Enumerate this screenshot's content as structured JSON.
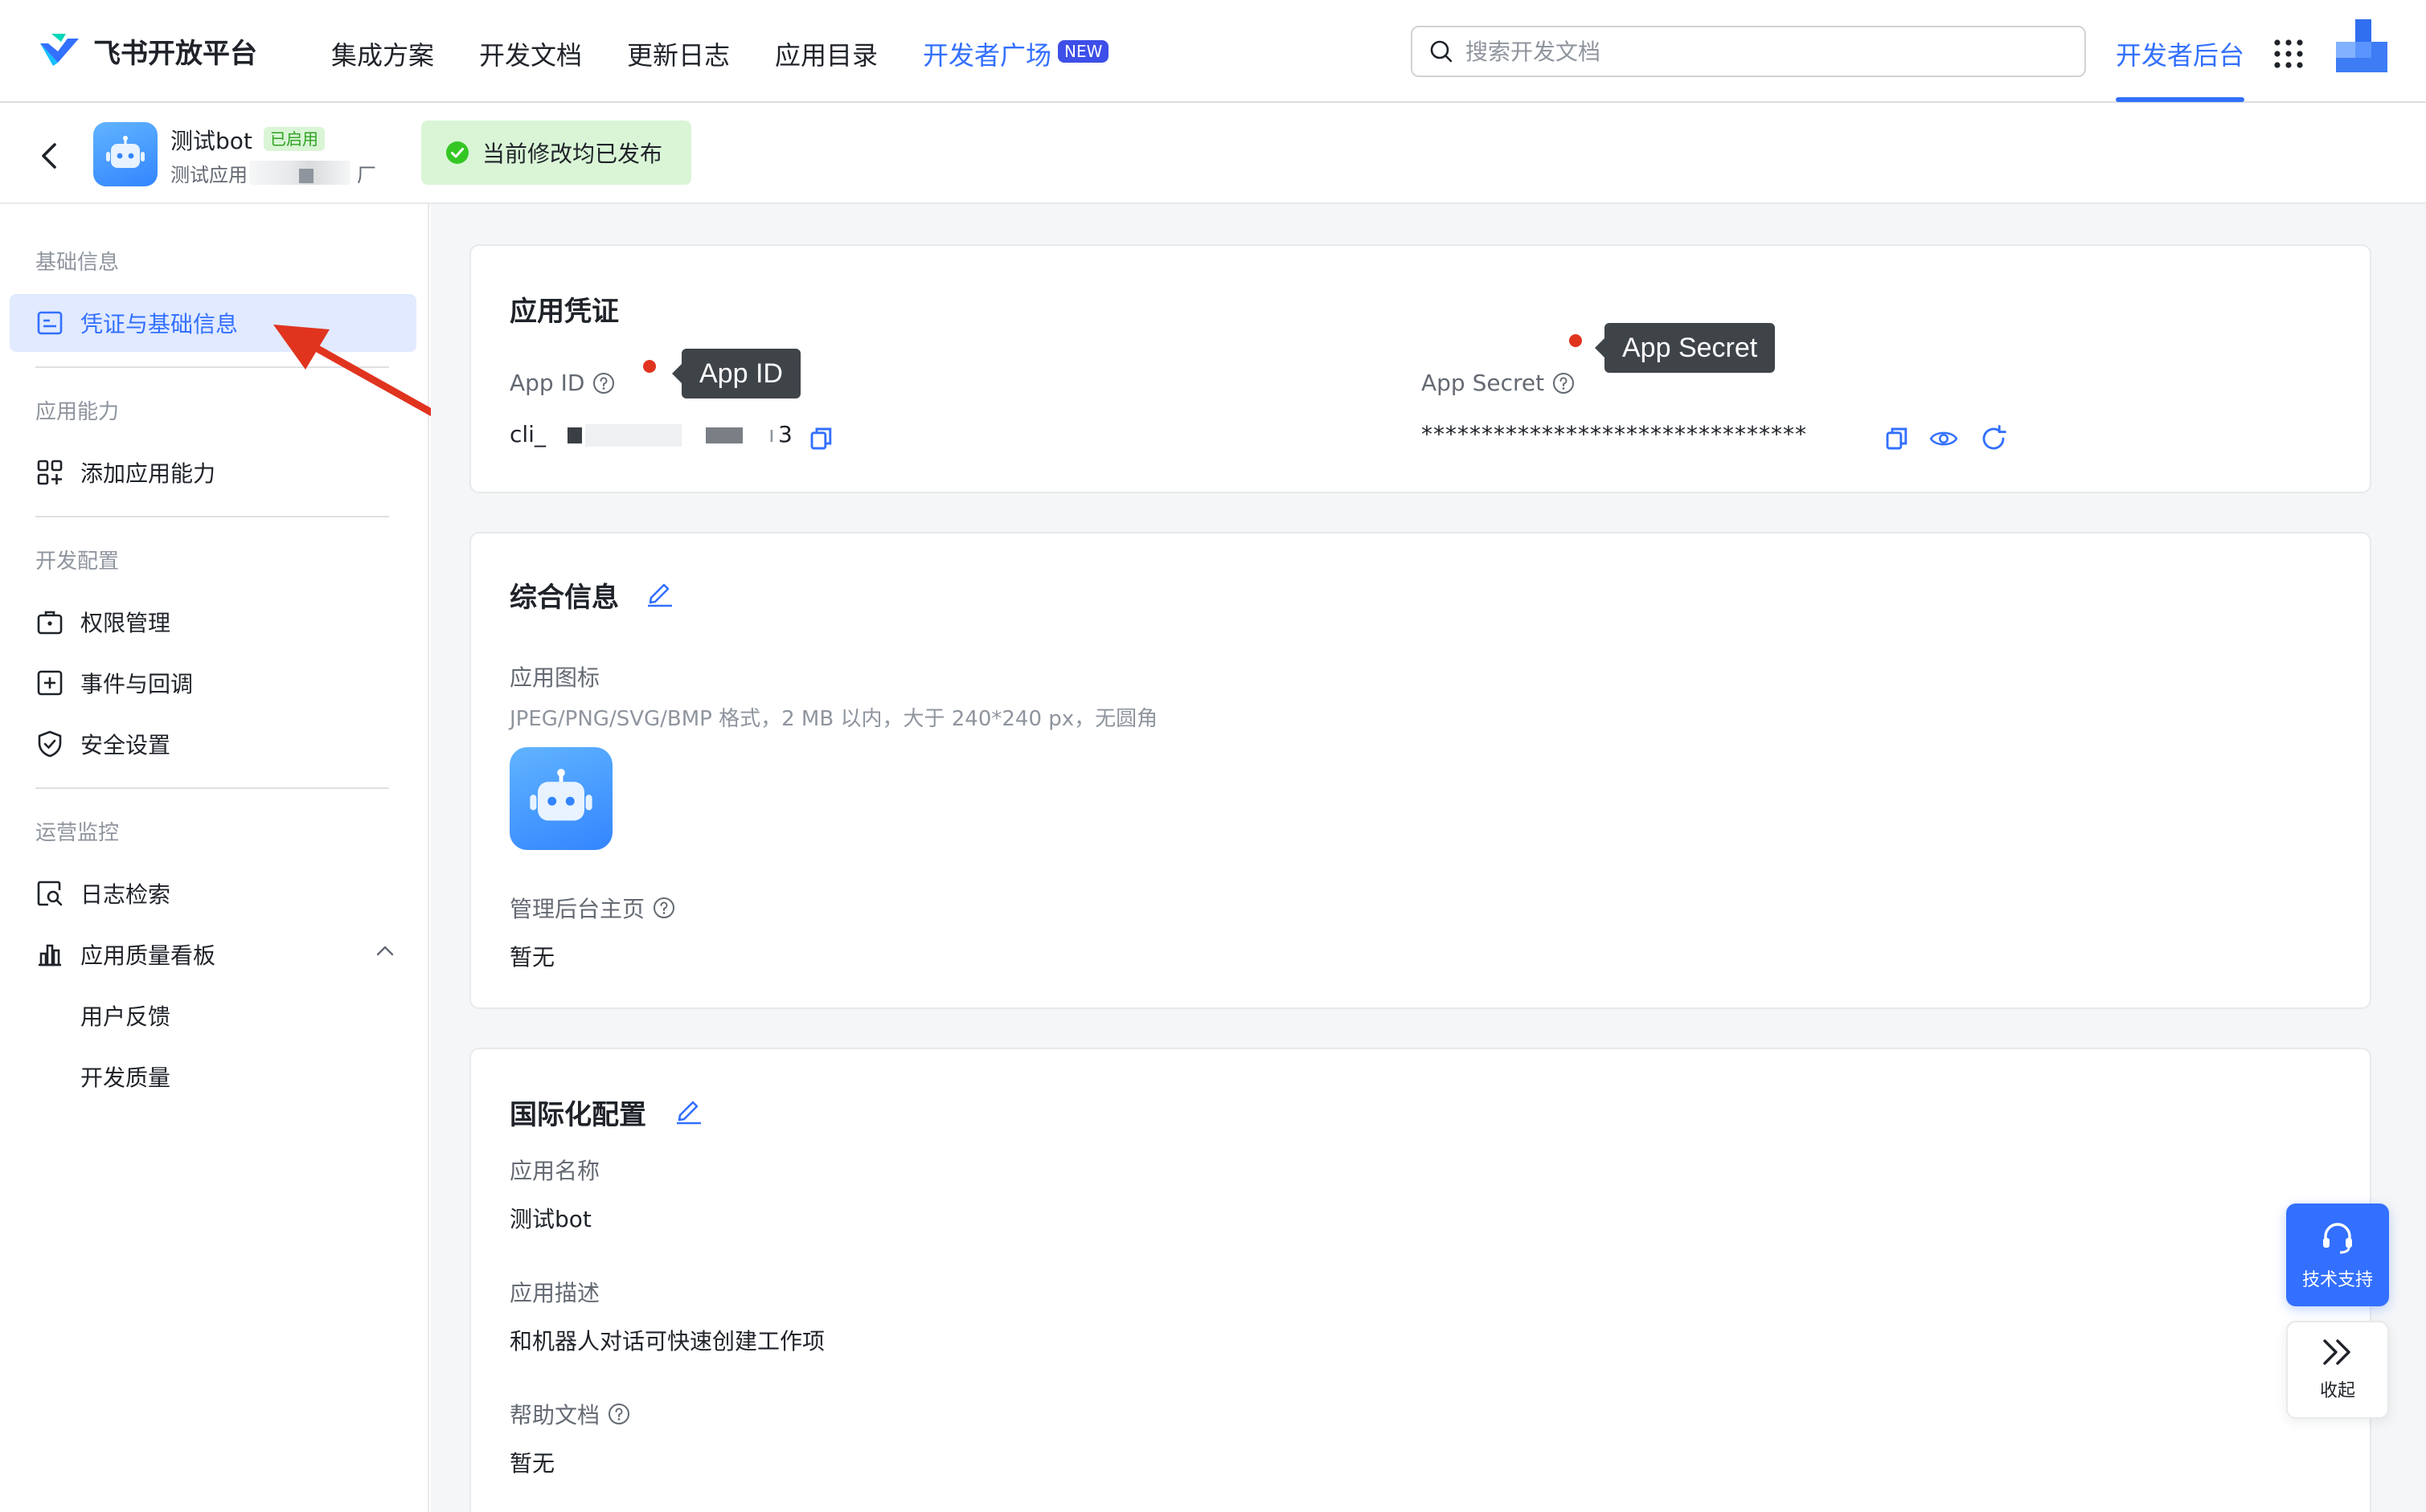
{
  "topnav": {
    "brand": "飞书开放平台",
    "items": [
      "集成方案",
      "开发文档",
      "更新日志",
      "应用目录"
    ],
    "featured": "开发者广场",
    "new_badge": "NEW",
    "search_placeholder": "搜索开发文档",
    "console": "开发者后台"
  },
  "app_header": {
    "name": "测试bot",
    "status": "已启用",
    "subtitle_start": "测试应用",
    "subtitle_end": "厂",
    "publish_status": "当前修改均已发布"
  },
  "sidebar": {
    "groups": {
      "basic": "基础信息",
      "capability": "应用能力",
      "dev": "开发配置",
      "ops": "运营监控"
    },
    "items": {
      "credentials": "凭证与基础信息",
      "add_capability": "添加应用能力",
      "permissions": "权限管理",
      "events": "事件与回调",
      "security": "安全设置",
      "logs": "日志检索",
      "quality_board": "应用质量看板",
      "feedback": "用户反馈",
      "dev_quality": "开发质量"
    }
  },
  "credentials": {
    "title": "应用凭证",
    "app_id_label": "App ID",
    "app_id_prefix": "cli_",
    "app_id_suffix": "3",
    "app_secret_label": "App Secret",
    "app_secret_value": "********************************",
    "tip_app_id": "App ID",
    "tip_app_secret": "App Secret"
  },
  "general": {
    "title": "综合信息",
    "icon_label": "应用图标",
    "icon_hint": "JPEG/PNG/SVG/BMP 格式，2 MB 以内，大于 240*240 px，无圆角",
    "admin_label": "管理后台主页",
    "admin_value": "暂无"
  },
  "i18n": {
    "title": "国际化配置",
    "name_label": "应用名称",
    "name_value": "测试bot",
    "desc_label": "应用描述",
    "desc_value": "和机器人对话可快速创建工作项",
    "help_label": "帮助文档",
    "help_value": "暂无"
  },
  "floating": {
    "support": "技术支持",
    "collapse": "收起"
  },
  "colors": {
    "accent": "#3370ff",
    "annotation_red": "#e0341f",
    "success_bg": "#d9f5d6"
  }
}
